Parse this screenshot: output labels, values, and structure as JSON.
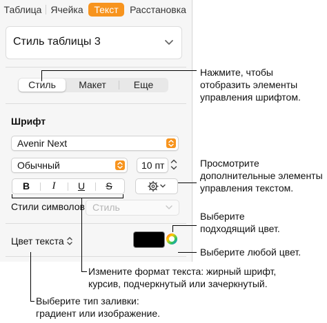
{
  "tabs": [
    "Таблица",
    "Ячейка",
    "Текст",
    "Расстановка"
  ],
  "active_tab": "Текст",
  "table_style": {
    "label": "Стиль таблицы 3",
    "icon": "chevron-down-icon"
  },
  "segments": [
    "Стиль",
    "Макет",
    "Еще"
  ],
  "active_segment": "Стиль",
  "font_section": {
    "title": "Шрифт",
    "font_name": "Avenir Next",
    "font_style": "Обычный",
    "font_size": "10 пт",
    "format_buttons": [
      "B",
      "I",
      "U",
      "S"
    ]
  },
  "char_styles": {
    "label": "Стили символов",
    "value": "Стиль"
  },
  "text_color": {
    "label": "Цвет текста",
    "swatch": "#000000"
  },
  "accent": "#f7941e",
  "callouts": {
    "font_controls": [
      "Нажмите, чтобы",
      "отобразить элементы",
      "управления шрифтом."
    ],
    "more_text": [
      "Просмотрите",
      "дополнительные элементы",
      "управления текстом."
    ],
    "matching_color": [
      "Выберите",
      "подходящий цвет."
    ],
    "any_color": "Выберите любой цвет.",
    "format": [
      "Измените формат текста: жирный шрифт,",
      "курсив, подчеркнутый или зачеркнутый."
    ],
    "fill": [
      "Выберите тип заливки:",
      "градиент или изображение."
    ]
  }
}
